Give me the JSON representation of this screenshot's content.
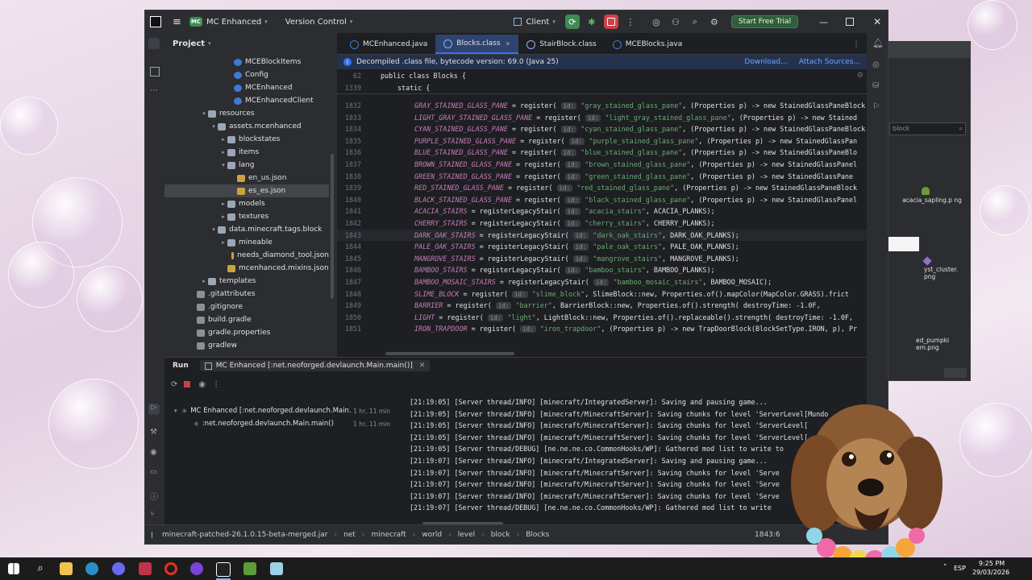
{
  "titlebar": {
    "project_badge": "MC",
    "project_name": "MC Enhanced",
    "vcs": "Version Control",
    "run_config": "Client",
    "trial": "Start Free Trial"
  },
  "project_panel": {
    "title": "Project",
    "rows": [
      {
        "label": "MCEBlockItems",
        "kind": "class"
      },
      {
        "label": "Config",
        "kind": "class"
      },
      {
        "label": "MCEnhanced",
        "kind": "class"
      },
      {
        "label": "MCEnhancedClient",
        "kind": "class"
      },
      {
        "label": "resources",
        "kind": "folder",
        "open": true
      },
      {
        "label": "assets.mcenhanced",
        "kind": "folder",
        "open": true
      },
      {
        "label": "blockstates",
        "kind": "folder"
      },
      {
        "label": "items",
        "kind": "folder"
      },
      {
        "label": "lang",
        "kind": "folder",
        "open": true
      },
      {
        "label": "en_us.json",
        "kind": "json"
      },
      {
        "label": "es_es.json",
        "kind": "json",
        "selected": true
      },
      {
        "label": "models",
        "kind": "folder"
      },
      {
        "label": "textures",
        "kind": "folder"
      },
      {
        "label": "data.minecraft.tags.block",
        "kind": "folder",
        "open": true
      },
      {
        "label": "mineable",
        "kind": "folder"
      },
      {
        "label": "needs_diamond_tool.json",
        "kind": "json"
      },
      {
        "label": "mcenhanced.mixins.json",
        "kind": "json"
      },
      {
        "label": "templates",
        "kind": "folder"
      },
      {
        "label": ".gitattributes",
        "kind": "file"
      },
      {
        "label": ".gitignore",
        "kind": "file"
      },
      {
        "label": "build.gradle",
        "kind": "file"
      },
      {
        "label": "gradle.properties",
        "kind": "file"
      },
      {
        "label": "gradlew",
        "kind": "file"
      }
    ]
  },
  "editor": {
    "tabs": [
      {
        "label": "MCEnhanced.java",
        "active": false
      },
      {
        "label": "Blocks.class",
        "active": true
      },
      {
        "label": "StairBlock.class",
        "active": false
      },
      {
        "label": "MCEBlocks.java",
        "active": false
      }
    ],
    "banner": "Decompiled .class file, bytecode version: 69.0 (Java 25)",
    "banner_download": "Download...",
    "banner_attach": "Attach Sources...",
    "sticky_1_num": "62",
    "sticky_1": "public class Blocks {",
    "sticky_2_num": "1339",
    "sticky_2": "static {",
    "lines": [
      {
        "n": "1832",
        "f": "GRAY_STAINED_GLASS_PANE",
        "c": "register",
        "s": "\"gray_stained_glass_pane\"",
        "rest": ", (Properties p) -> new StainedGlassPaneBlock"
      },
      {
        "n": "1833",
        "f": "LIGHT_GRAY_STAINED_GLASS_PANE",
        "c": "register",
        "s": "\"light_gray_stained_glass_pane\"",
        "rest": ", (Properties p) -> new Stained"
      },
      {
        "n": "1834",
        "f": "CYAN_STAINED_GLASS_PANE",
        "c": "register",
        "s": "\"cyan_stained_glass_pane\"",
        "rest": ", (Properties p) -> new StainedGlassPaneBlock"
      },
      {
        "n": "1835",
        "f": "PURPLE_STAINED_GLASS_PANE",
        "c": "register",
        "s": "\"purple_stained_glass_pane\"",
        "rest": ", (Properties p) -> new StainedGlassPan"
      },
      {
        "n": "1836",
        "f": "BLUE_STAINED_GLASS_PANE",
        "c": "register",
        "s": "\"blue_stained_glass_pane\"",
        "rest": ", (Properties p) -> new StainedGlassPaneBlo"
      },
      {
        "n": "1837",
        "f": "BROWN_STAINED_GLASS_PANE",
        "c": "register",
        "s": "\"brown_stained_glass_pane\"",
        "rest": ", (Properties p) -> new StainedGlassPanel"
      },
      {
        "n": "1838",
        "f": "GREEN_STAINED_GLASS_PANE",
        "c": "register",
        "s": "\"green_stained_glass_pane\"",
        "rest": ", (Properties p) -> new StainedGlassPane"
      },
      {
        "n": "1839",
        "f": "RED_STAINED_GLASS_PANE",
        "c": "register",
        "s": "\"red_stained_glass_pane\"",
        "rest": ", (Properties p) -> new StainedGlassPaneBlock"
      },
      {
        "n": "1840",
        "f": "BLACK_STAINED_GLASS_PANE",
        "c": "register",
        "s": "\"black_stained_glass_pane\"",
        "rest": ", (Properties p) -> new StainedGlassPanel"
      },
      {
        "n": "1841",
        "f": "ACACIA_STAIRS",
        "c": "registerLegacyStair",
        "s": "\"acacia_stairs\"",
        "rest": ", ACACIA_PLANKS);"
      },
      {
        "n": "1842",
        "f": "CHERRY_STAIRS",
        "c": "registerLegacyStair",
        "s": "\"cherry_stairs\"",
        "rest": ", CHERRY_PLANKS);"
      },
      {
        "n": "1843",
        "f": "DARK_OAK_STAIRS",
        "c": "registerLegacyStair",
        "s": "\"dark_oak_stairs\"",
        "rest": ", DARK_OAK_PLANKS);",
        "current": true
      },
      {
        "n": "1844",
        "f": "PALE_OAK_STAIRS",
        "c": "registerLegacyStair",
        "s": "\"pale_oak_stairs\"",
        "rest": ", PALE_OAK_PLANKS);"
      },
      {
        "n": "1845",
        "f": "MANGROVE_STAIRS",
        "c": "registerLegacyStair",
        "s": "\"mangrove_stairs\"",
        "rest": ", MANGROVE_PLANKS);"
      },
      {
        "n": "1846",
        "f": "BAMBOO_STAIRS",
        "c": "registerLegacyStair",
        "s": "\"bamboo_stairs\"",
        "rest": ", BAMBOO_PLANKS);"
      },
      {
        "n": "1847",
        "f": "BAMBOO_MOSAIC_STAIRS",
        "c": "registerLegacyStair",
        "s": "\"bamboo_mosaic_stairs\"",
        "rest": ", BAMBOO_MOSAIC);"
      },
      {
        "n": "1848",
        "f": "SLIME_BLOCK",
        "c": "register",
        "s": "\"slime_block\"",
        "rest": ", SlimeBlock::new, Properties.of().mapColor(MapColor.GRASS).frict"
      },
      {
        "n": "1849",
        "f": "BARRIER",
        "c": "register",
        "s": "\"barrier\"",
        "rest": ", BarrierBlock::new, Properties.of().strength( destroyTime: -1.0F,"
      },
      {
        "n": "1850",
        "f": "LIGHT",
        "c": "register",
        "s": "\"light\"",
        "rest": ", LightBlock::new, Properties.of().replaceable().strength( destroyTime: -1.0F,"
      },
      {
        "n": "1851",
        "f": "IRON_TRAPDOOR",
        "c": "register",
        "s": "\"iron_trapdoor\"",
        "rest": ", (Properties p) -> new TrapDoorBlock(BlockSetType.IRON, p), Pr"
      }
    ]
  },
  "run": {
    "label": "Run",
    "tab": "MC Enhanced [:net.neoforged.devlaunch.Main.main()]",
    "tree": [
      {
        "label": "MC Enhanced [:net.neoforged.devlaunch.Main.",
        "time": "1 hr, 11 min"
      },
      {
        "label": ":net.neoforged.devlaunch.Main.main()",
        "time": "1 hr, 11 min"
      }
    ],
    "console": [
      "[21:19:05] [Server thread/INFO] [minecraft/IntegratedServer]: Saving and pausing game...",
      "[21:19:05] [Server thread/INFO] [minecraft/MinecraftServer]: Saving chunks for level 'ServerLevel[Mundo",
      "[21:19:05] [Server thread/INFO] [minecraft/MinecraftServer]: Saving chunks for level 'ServerLevel[",
      "[21:19:05] [Server thread/INFO] [minecraft/MinecraftServer]: Saving chunks for level 'ServerLevel[",
      "[21:19:05] [Server thread/DEBUG] [ne.ne.ne.co.CommonHooks/WP]: Gathered mod list to write to",
      "[21:19:07] [Server thread/INFO] [minecraft/IntegratedServer]: Saving and pausing game...",
      "[21:19:07] [Server thread/INFO] [minecraft/MinecraftServer]: Saving chunks for level 'Serve",
      "[21:19:07] [Server thread/INFO] [minecraft/MinecraftServer]: Saving chunks for level 'Serve",
      "[21:19:07] [Server thread/INFO] [minecraft/MinecraftServer]: Saving chunks for level 'Serve",
      "[21:19:07] [Server thread/DEBUG] [ne.ne.ne.co.CommonHooks/WP]: Gathered mod list to write"
    ]
  },
  "statusbar": {
    "crumbs": [
      "minecraft-patched-26.1.0.15-beta-merged.jar",
      "net",
      "minecraft",
      "world",
      "level",
      "block",
      "Blocks"
    ],
    "position": "1843:6"
  },
  "side_window": {
    "search": "block",
    "item1": "acacia_sapling.p ng",
    "item2": "yst_cluster. png",
    "item3": "ed_pumpki em.png"
  },
  "taskbar": {
    "lang": "ESP",
    "time": "9:25 PM",
    "date": "29/03/2026"
  },
  "colors": {
    "accent": "#3574f0",
    "trial_green": "#2f5e3a",
    "string": "#6aab73",
    "field": "#c77dbb"
  }
}
